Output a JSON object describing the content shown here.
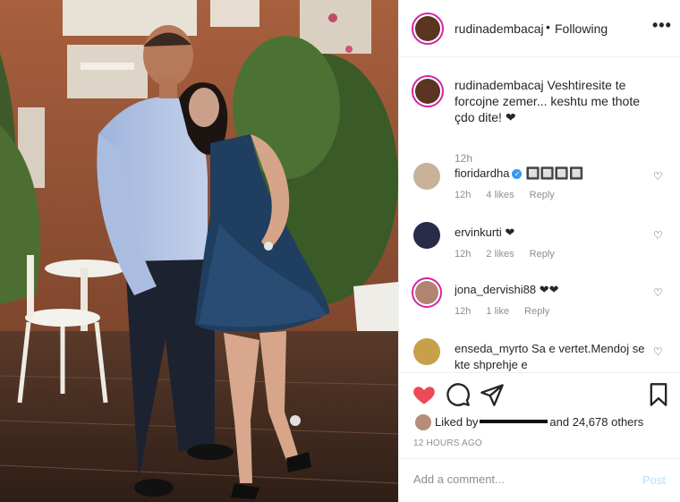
{
  "post": {
    "username": "rudinadembacaj",
    "dot": "•",
    "follow_state": "Following",
    "more": "•••"
  },
  "caption": {
    "username": "rudinadembacaj",
    "text": "Veshtiresite te forcojne zemer... keshtu me thote çdo dite! ❤",
    "time": "12h"
  },
  "comments": [
    {
      "username": "fioridardha",
      "verified": true,
      "text": "🔲🔲🔲🔲",
      "time": "12h",
      "likes": "4 likes",
      "reply": "Reply"
    },
    {
      "username": "ervinkurti",
      "verified": false,
      "text": "❤",
      "time": "12h",
      "likes": "2 likes",
      "reply": "Reply"
    },
    {
      "username": "jona_dervishi88",
      "verified": false,
      "text": "❤❤",
      "time": "12h",
      "likes": "1 like",
      "reply": "Reply"
    },
    {
      "username": "enseda_myrto",
      "verified": false,
      "text": "Sa e vertet.Mendoj se kte shprehje e",
      "time": "",
      "likes": "",
      "reply": ""
    }
  ],
  "likes_line": {
    "prefix": "Liked by",
    "suffix": "and 24,678 others"
  },
  "timestamp": "12 HOURS AGO",
  "comment_box": {
    "placeholder": "Add a comment...",
    "post_label": "Post"
  },
  "icons": [
    "heart-filled-icon",
    "comment-icon",
    "share-icon",
    "bookmark-icon",
    "more-icon",
    "heart-outline-icon"
  ],
  "colors": {
    "like_red": "#ed4956",
    "verified_blue": "#3897f0",
    "post_disabled": "#b2dffc",
    "story_ring": "#d6249f"
  }
}
